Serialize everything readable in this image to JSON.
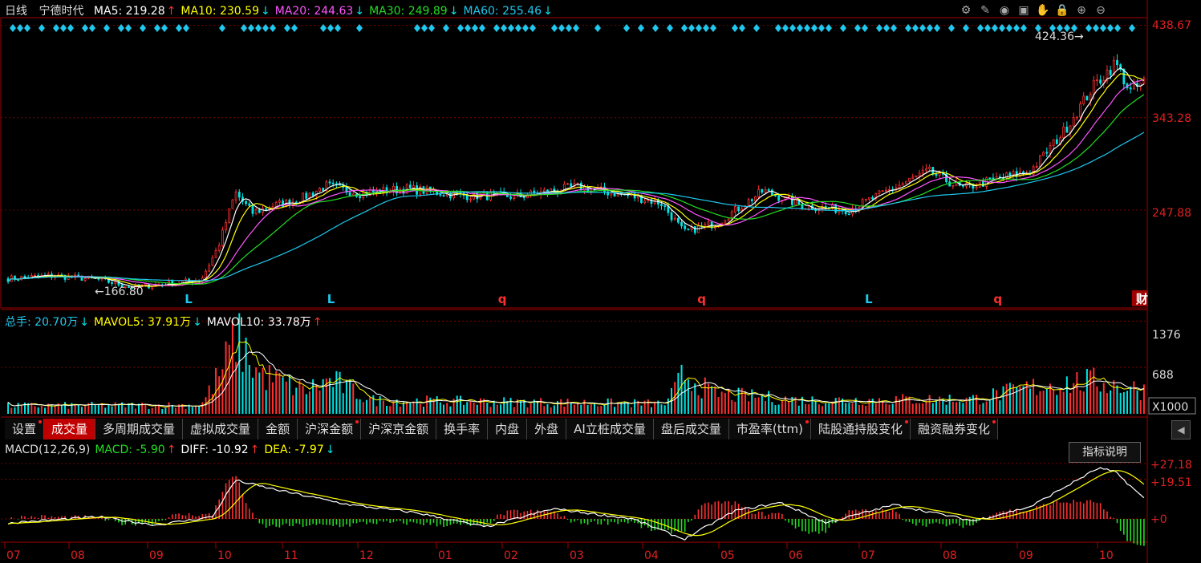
{
  "header": {
    "period": "日线",
    "stock_name": "宁德时代",
    "ma": [
      {
        "label": "MA5: 219.28",
        "arrow": "↑",
        "color": "#ffffff",
        "arrow_color": "#ff3030"
      },
      {
        "label": "MA10: 230.59",
        "arrow": "↓",
        "color": "#ffff00",
        "arrow_color": "#00e5e5"
      },
      {
        "label": "MA20: 244.63",
        "arrow": "↓",
        "color": "#ff55ff",
        "arrow_color": "#00e5e5"
      },
      {
        "label": "MA30: 249.89",
        "arrow": "↓",
        "color": "#22dd22",
        "arrow_color": "#00e5e5"
      },
      {
        "label": "MA60: 255.46",
        "arrow": "↓",
        "color": "#1ec8ee",
        "arrow_color": "#00e5e5"
      }
    ]
  },
  "toolbar": [
    "gear-icon",
    "pen-icon",
    "eye-icon",
    "briefcase-icon",
    "hand-icon",
    "lock-icon",
    "zoom-in-icon",
    "zoom-out-icon"
  ],
  "price_panel": {
    "y_ticks": [
      "438.67",
      "343.28",
      "247.88"
    ],
    "high_marker": "424.36",
    "low_marker": "166.80",
    "signals": [
      {
        "text": "L",
        "color": "#1ec8ee",
        "pos": 0.16
      },
      {
        "text": "L",
        "color": "#1ec8ee",
        "pos": 0.285
      },
      {
        "text": "q",
        "color": "#ff3030",
        "pos": 0.435
      },
      {
        "text": "q",
        "color": "#ff3030",
        "pos": 0.61
      },
      {
        "text": "L",
        "color": "#1ec8ee",
        "pos": 0.757
      },
      {
        "text": "q",
        "color": "#ff3030",
        "pos": 0.87
      },
      {
        "text": "财",
        "color": "#ffffff",
        "pos": 0.995
      }
    ]
  },
  "volume_panel": {
    "header": [
      {
        "label": "总手: 20.70万",
        "arrow": "↓",
        "color": "#1ec8ee",
        "arrow_color": "#00e5e5"
      },
      {
        "label": "MAVOL5: 37.91万",
        "arrow": "↓",
        "color": "#ffff00",
        "arrow_color": "#00e5e5"
      },
      {
        "label": "MAVOL10: 33.78万",
        "arrow": "↑",
        "color": "#ffffff",
        "arrow_color": "#ff3030"
      }
    ],
    "y_ticks": [
      "1376",
      "688"
    ],
    "unit": "X1000"
  },
  "tabs": [
    {
      "label": "设置",
      "dot": true,
      "active": false
    },
    {
      "label": "成交量",
      "dot": false,
      "active": true
    },
    {
      "label": "多周期成交量",
      "dot": false,
      "active": false
    },
    {
      "label": "虚拟成交量",
      "dot": false,
      "active": false
    },
    {
      "label": "金额",
      "dot": false,
      "active": false
    },
    {
      "label": "沪深金额",
      "dot": true,
      "active": false
    },
    {
      "label": "沪深京金额",
      "dot": false,
      "active": false
    },
    {
      "label": "换手率",
      "dot": false,
      "active": false
    },
    {
      "label": "内盘",
      "dot": false,
      "active": false
    },
    {
      "label": "外盘",
      "dot": false,
      "active": false
    },
    {
      "label": "AI立桩成交量",
      "dot": false,
      "active": false
    },
    {
      "label": "盘后成交量",
      "dot": false,
      "active": false
    },
    {
      "label": "市盈率(ttm)",
      "dot": true,
      "active": false
    },
    {
      "label": "陆股通持股变化",
      "dot": true,
      "active": false
    },
    {
      "label": "融资融券变化",
      "dot": true,
      "active": false
    }
  ],
  "macd_panel": {
    "header": [
      {
        "label": "MACD(12,26,9)",
        "arrow": "",
        "color": "#dddddd",
        "arrow_color": "#dddddd"
      },
      {
        "label": "MACD: -5.90",
        "arrow": "↑",
        "color": "#22dd22",
        "arrow_color": "#ff3030"
      },
      {
        "label": "DIFF: -10.92",
        "arrow": "↑",
        "color": "#ffffff",
        "arrow_color": "#ff3030"
      },
      {
        "label": "DEA: -7.97",
        "arrow": "↓",
        "color": "#ffff00",
        "arrow_color": "#00e5e5"
      }
    ],
    "help_button": "指标说明",
    "y_ticks": [
      "+27.18",
      "+19.51",
      "+0"
    ]
  },
  "months": [
    "07",
    "08",
    "09",
    "10",
    "11",
    "12",
    "01",
    "02",
    "03",
    "04",
    "05",
    "06",
    "07",
    "08",
    "09",
    "10"
  ],
  "colors": {
    "up": "#ff3030",
    "down": "#00e5e5",
    "grid": "#7a0000",
    "axis": "#a00000"
  },
  "chart_data": {
    "type": "candlestick",
    "title": "宁德时代 日线",
    "ylim": [
      150,
      445
    ],
    "close_key_points": [
      {
        "t": 0.0,
        "v": 177
      },
      {
        "t": 0.04,
        "v": 180
      },
      {
        "t": 0.08,
        "v": 176
      },
      {
        "t": 0.11,
        "v": 168
      },
      {
        "t": 0.15,
        "v": 173
      },
      {
        "t": 0.17,
        "v": 176
      },
      {
        "t": 0.185,
        "v": 210
      },
      {
        "t": 0.2,
        "v": 266
      },
      {
        "t": 0.215,
        "v": 245
      },
      {
        "t": 0.235,
        "v": 253
      },
      {
        "t": 0.255,
        "v": 258
      },
      {
        "t": 0.28,
        "v": 273
      },
      {
        "t": 0.31,
        "v": 265
      },
      {
        "t": 0.35,
        "v": 270
      },
      {
        "t": 0.4,
        "v": 263
      },
      {
        "t": 0.45,
        "v": 262
      },
      {
        "t": 0.5,
        "v": 272
      },
      {
        "t": 0.55,
        "v": 262
      },
      {
        "t": 0.575,
        "v": 255
      },
      {
        "t": 0.595,
        "v": 225
      },
      {
        "t": 0.625,
        "v": 235
      },
      {
        "t": 0.665,
        "v": 268
      },
      {
        "t": 0.7,
        "v": 252
      },
      {
        "t": 0.74,
        "v": 248
      },
      {
        "t": 0.775,
        "v": 268
      },
      {
        "t": 0.81,
        "v": 288
      },
      {
        "t": 0.84,
        "v": 270
      },
      {
        "t": 0.87,
        "v": 280
      },
      {
        "t": 0.9,
        "v": 288
      },
      {
        "t": 0.93,
        "v": 330
      },
      {
        "t": 0.955,
        "v": 375
      },
      {
        "t": 0.975,
        "v": 400
      },
      {
        "t": 0.988,
        "v": 370
      },
      {
        "t": 1.0,
        "v": 380
      }
    ],
    "ma_series": [
      {
        "name": "MA5",
        "color": "#ffffff",
        "smooth": 2
      },
      {
        "name": "MA10",
        "color": "#ffff00",
        "smooth": 4
      },
      {
        "name": "MA20",
        "color": "#ff55ff",
        "smooth": 8
      },
      {
        "name": "MA30",
        "color": "#22dd22",
        "smooth": 13
      },
      {
        "name": "MA60",
        "color": "#1ec8ee",
        "smooth": 26
      }
    ],
    "volume_key_points": [
      {
        "t": 0.0,
        "v": 120
      },
      {
        "t": 0.17,
        "v": 130
      },
      {
        "t": 0.19,
        "v": 700
      },
      {
        "t": 0.2,
        "v": 1150
      },
      {
        "t": 0.22,
        "v": 600
      },
      {
        "t": 0.26,
        "v": 350
      },
      {
        "t": 0.285,
        "v": 500
      },
      {
        "t": 0.32,
        "v": 200
      },
      {
        "t": 0.58,
        "v": 150
      },
      {
        "t": 0.595,
        "v": 600
      },
      {
        "t": 0.62,
        "v": 300
      },
      {
        "t": 0.7,
        "v": 200
      },
      {
        "t": 0.85,
        "v": 220
      },
      {
        "t": 0.92,
        "v": 450
      },
      {
        "t": 0.96,
        "v": 480
      },
      {
        "t": 1.0,
        "v": 350
      }
    ],
    "macd_key_points": [
      {
        "t": 0.0,
        "v": -2
      },
      {
        "t": 0.08,
        "v": 1
      },
      {
        "t": 0.13,
        "v": -3
      },
      {
        "t": 0.18,
        "v": 1
      },
      {
        "t": 0.2,
        "v": 19
      },
      {
        "t": 0.23,
        "v": 15
      },
      {
        "t": 0.3,
        "v": 7
      },
      {
        "t": 0.36,
        "v": 3
      },
      {
        "t": 0.42,
        "v": -4
      },
      {
        "t": 0.48,
        "v": 5
      },
      {
        "t": 0.55,
        "v": 0
      },
      {
        "t": 0.595,
        "v": -10
      },
      {
        "t": 0.64,
        "v": 4
      },
      {
        "t": 0.68,
        "v": 8
      },
      {
        "t": 0.72,
        "v": -2
      },
      {
        "t": 0.78,
        "v": 7
      },
      {
        "t": 0.85,
        "v": -1
      },
      {
        "t": 0.9,
        "v": 6
      },
      {
        "t": 0.96,
        "v": 25
      },
      {
        "t": 0.975,
        "v": 23
      },
      {
        "t": 1.0,
        "v": 10
      }
    ]
  }
}
